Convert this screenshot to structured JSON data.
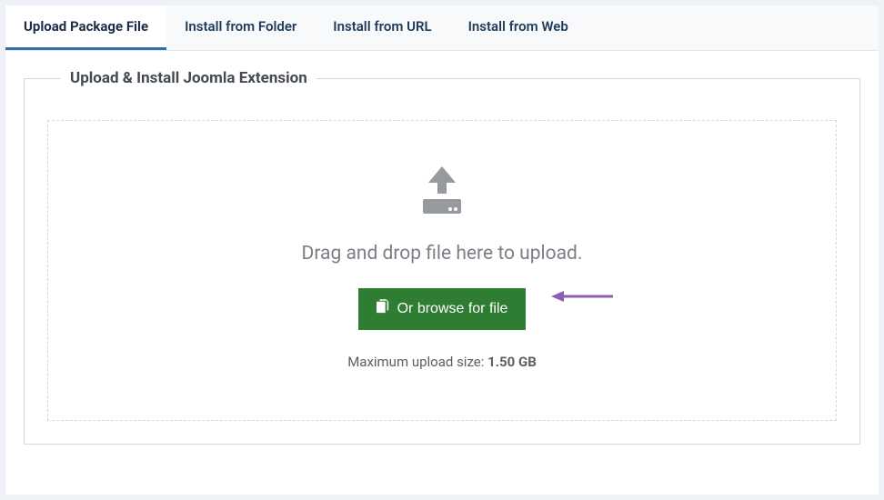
{
  "tabs": {
    "upload": "Upload Package File",
    "folder": "Install from Folder",
    "url": "Install from URL",
    "web": "Install from Web"
  },
  "panel": {
    "legend": "Upload & Install Joomla Extension",
    "drop_text": "Drag and drop file here to upload.",
    "browse_label": "Or browse for file",
    "max_label": "Maximum upload size: ",
    "max_value": "1.50 GB"
  }
}
